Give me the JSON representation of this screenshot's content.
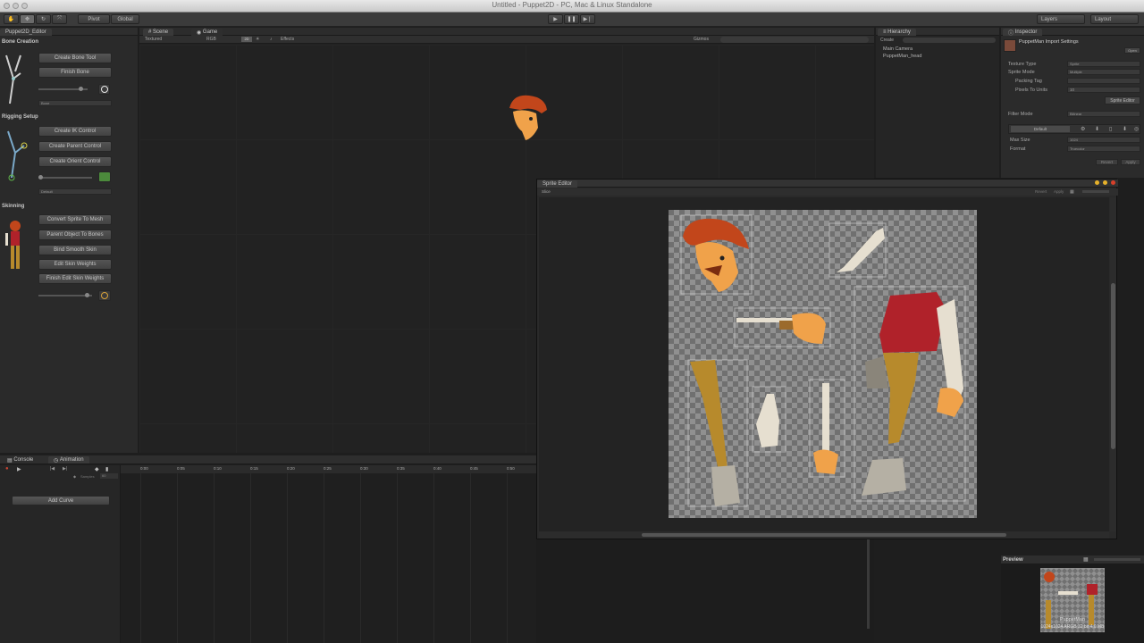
{
  "window": {
    "title": "Untitled - Puppet2D - PC, Mac & Linux Standalone"
  },
  "toolbar": {
    "pivot": "Pivot",
    "global": "Global",
    "layers": "Layers",
    "layout": "Layout"
  },
  "editor": {
    "tab": "Puppet2D_Editor",
    "bone_creation": "Bone Creation",
    "create_bone_tool": "Create Bone Tool",
    "finish_bone": "Finish Bone",
    "bone_dropdown": "Bone",
    "rigging_setup": "Rigging Setup",
    "create_ik_control": "Create IK Control",
    "create_parent_control": "Create Parent Control",
    "create_orient_control": "Create Orient Control",
    "rig_dropdown": "Default",
    "skinning": "Skinning",
    "convert_sprite_to_mesh": "Convert Sprite To Mesh",
    "parent_object_to_bones": "Parent Object To Bones",
    "bind_smooth_skin": "Bind Smooth Skin",
    "edit_skin_weights": "Edit Skin Weights",
    "finish_edit_skin_weights": "Finish Edit Skin Weights"
  },
  "scene": {
    "tabs": [
      "Scene",
      "Game"
    ],
    "shading": "Textured",
    "color_mode": "RGB",
    "mode_2d": "2D",
    "effects": "Effects",
    "gizmos": "Gizmos"
  },
  "hierarchy": {
    "tab": "Hierarchy",
    "create": "Create",
    "items": [
      "Main Camera",
      "PuppetMan_head"
    ]
  },
  "inspector": {
    "tab": "Inspector",
    "title": "PuppetMan Import Settings",
    "open": "Open",
    "texture_type_label": "Texture Type",
    "texture_type": "Sprite",
    "sprite_mode_label": "Sprite Mode",
    "sprite_mode": "Multiple",
    "packing_tag_label": "Packing Tag",
    "packing_tag": "",
    "ppu_label": "Pixels To Units",
    "ppu": "10",
    "sprite_editor_btn": "Sprite Editor",
    "filter_mode_label": "Filter Mode",
    "filter_mode": "Bilinear",
    "default_btn": "Default",
    "max_size_label": "Max Size",
    "max_size": "1024",
    "format_label": "Format",
    "format": "Truecolor",
    "revert": "Revert",
    "apply": "Apply"
  },
  "sprite_editor": {
    "title": "Sprite Editor",
    "slice": "Slice",
    "revert": "Revert",
    "apply": "Apply"
  },
  "bottom": {
    "tabs": [
      "Console",
      "Animation"
    ],
    "add_curve": "Add Curve",
    "ticks": [
      "0:00",
      "0:05",
      "0:10",
      "0:15",
      "0:20",
      "0:25",
      "0:30",
      "0:35",
      "0:40",
      "0:45",
      "0:50"
    ],
    "samples_label": "Samples",
    "samples": "60"
  },
  "preview": {
    "label": "Preview",
    "name": "PuppetMan",
    "info": "1024x1024  ARGB 32 bit  4.0 MB"
  },
  "colors": {
    "accent": "#3d6fb0",
    "hair": "#c2461b",
    "skin": "#f0a24a",
    "shirt": "#b0222a",
    "pants": "#b78a2c",
    "bone": "#e6dfd0"
  }
}
